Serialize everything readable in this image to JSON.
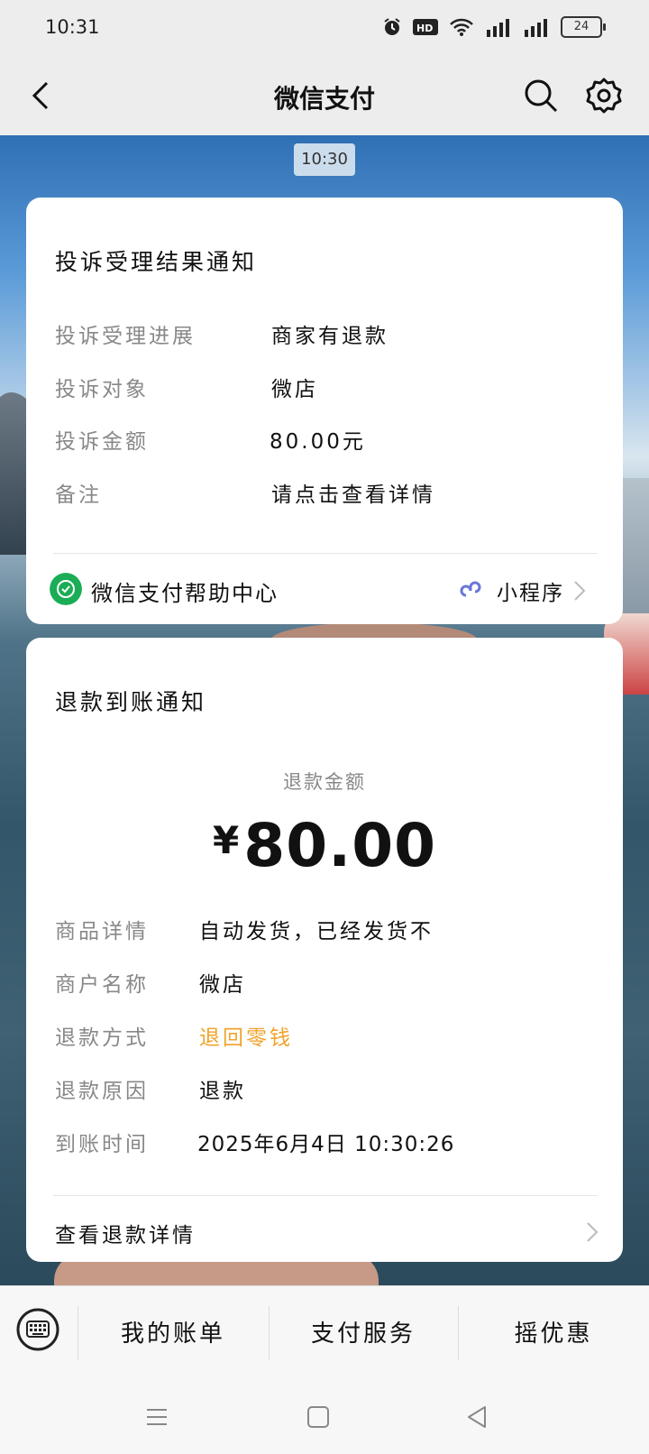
{
  "status_bar": {
    "time": "10:31",
    "battery": "24"
  },
  "nav": {
    "title": "微信支付"
  },
  "time_chip": "10:30",
  "complaint_card": {
    "title": "投诉受理结果通知",
    "rows": [
      {
        "label": "投诉受理进展",
        "value": "商家有退款"
      },
      {
        "label": "投诉对象",
        "value": "微店"
      },
      {
        "label": "投诉金额",
        "value": "80.00元"
      },
      {
        "label": "备注",
        "value": "请点击查看详情"
      }
    ],
    "footer_left": "微信支付帮助中心",
    "footer_right": "小程序"
  },
  "refund_card": {
    "title": "退款到账通知",
    "amount_label": "退款金额",
    "currency": "¥",
    "amount": "80.00",
    "rows": [
      {
        "label": "商品详情",
        "value": "自动发货，已经发货不"
      },
      {
        "label": "商户名称",
        "value": "微店"
      },
      {
        "label": "退款方式",
        "value": "退回零钱"
      },
      {
        "label": "退款原因",
        "value": "退款"
      },
      {
        "label": "到账时间",
        "value": "2025年6月4日 10:30:26"
      }
    ],
    "footer": "查看退款详情",
    "highlight_color": "#f0a32a"
  },
  "menu": {
    "items": [
      "我的账单",
      "支付服务",
      "摇优惠"
    ]
  }
}
